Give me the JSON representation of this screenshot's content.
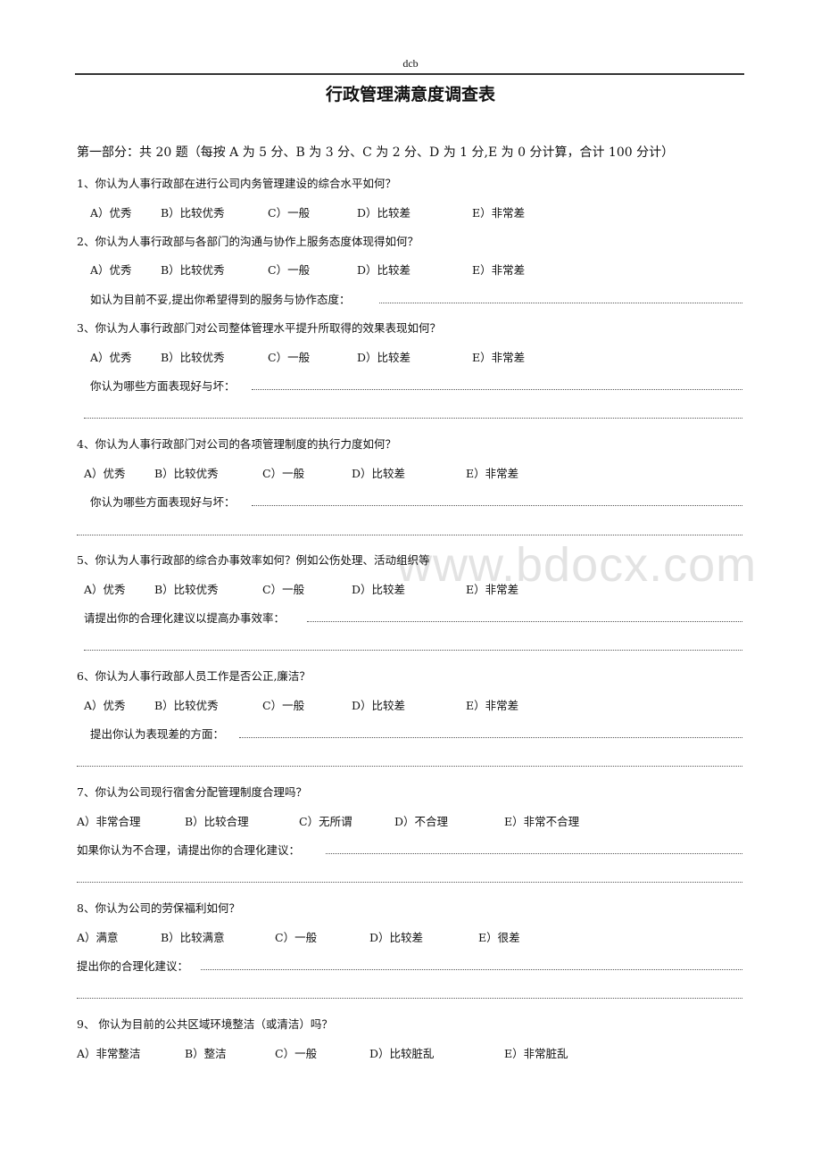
{
  "header": {
    "text": "dcb"
  },
  "title": "行政管理满意度调查表",
  "intro": "第一部分：共 20 题（每按 A 为 5 分、B 为 3 分、C 为 2 分、D 为 1 分,E 为 0 分计算，合计 100 分计）",
  "watermark": "www.bdocx.com",
  "questions": [
    {
      "text": "1、你认为人事行政部在进行公司内务管理建设的综合水平如何？",
      "options": [
        "A）优秀",
        "B）比较优秀",
        "C）一般",
        "D）比较差",
        "E）非常差"
      ]
    },
    {
      "text": "2、你认为人事行政部与各部门的沟通与协作上服务态度体现得如何？",
      "options": [
        "A）优秀",
        "B）比较优秀",
        "C）一般",
        "D）比较差",
        "E）非常差"
      ],
      "prompt": "如认为目前不妥,提出你希望得到的服务与协作态度："
    },
    {
      "text": "3、你认为人事行政部门对公司整体管理水平提升所取得的效果表现如何？",
      "options": [
        "A）优秀",
        "B）比较优秀",
        "C）一般",
        "D）比较差",
        "E）非常差"
      ],
      "prompt": "你认为哪些方面表现好与坏："
    },
    {
      "text": "4、你认为人事行政部门对公司的各项管理制度的执行力度如何？",
      "options": [
        "A）优秀",
        "B）比较优秀",
        "C）一般",
        "D）比较差",
        "E）非常差"
      ],
      "prompt": "你认为哪些方面表现好与坏："
    },
    {
      "text": "5、你认为人事行政部的综合办事效率如何？例如公伤处理、活动组织等",
      "options": [
        "A）优秀",
        "B）比较优秀",
        "C）一般",
        "D）比较差",
        "E）非常差"
      ],
      "prompt": "请提出你的合理化建议以提高办事效率："
    },
    {
      "text": "6、你认为人事行政部人员工作是否公正,廉洁？",
      "options": [
        "A）优秀",
        "B）比较优秀",
        "C）一般",
        "D）比较差",
        "E）非常差"
      ],
      "prompt": "提出你认为表现差的方面："
    },
    {
      "text": "7、你认为公司现行宿舍分配管理制度合理吗？",
      "options": [
        "A）非常合理",
        "B）比较合理",
        "C）无所谓",
        "D）不合理",
        "E）非常不合理"
      ],
      "prompt": "如果你认为不合理，请提出你的合理化建议："
    },
    {
      "text": "8、你认为公司的劳保福利如何？",
      "options": [
        "A）满意",
        "B）比较满意",
        "C）一般",
        "D）比较差",
        "E）很差"
      ],
      "prompt": "提出你的合理化建议："
    },
    {
      "text": "9、 你认为目前的公共区域环境整洁（或清洁）吗？",
      "options": [
        "A）非常整洁",
        "B）整洁",
        "C）一般",
        "D）比较脏乱",
        "E）非常脏乱"
      ]
    }
  ]
}
